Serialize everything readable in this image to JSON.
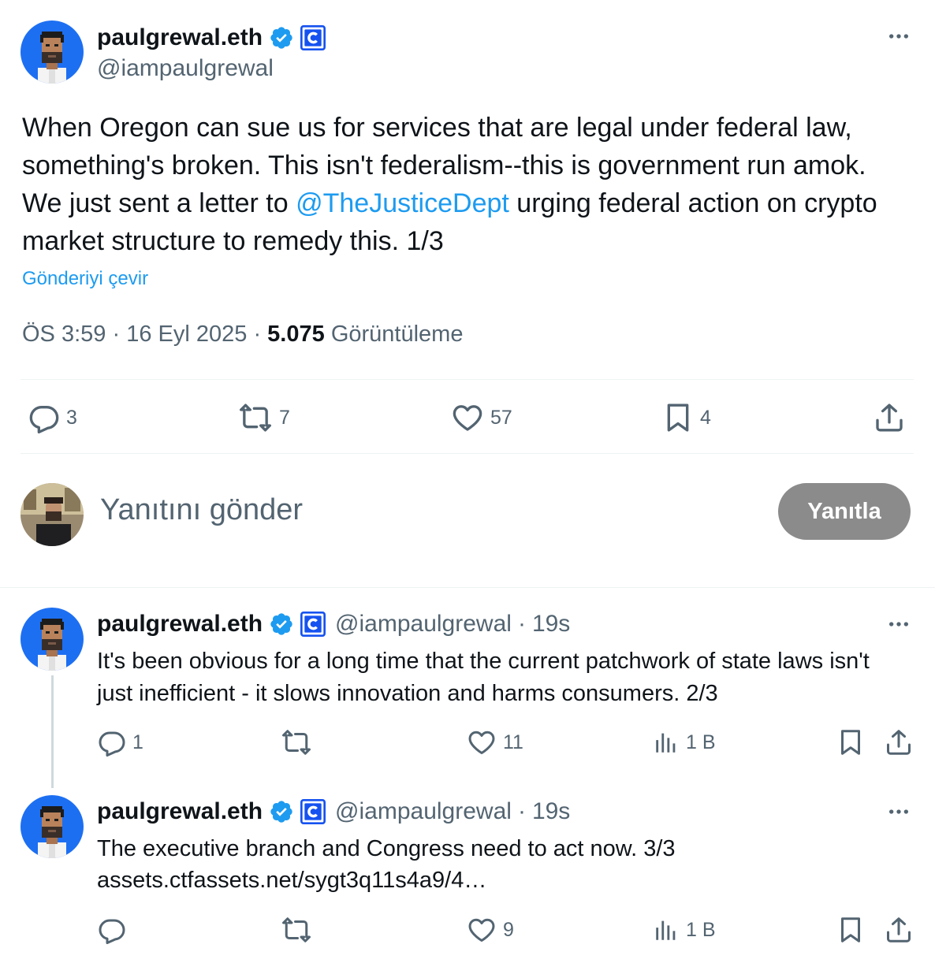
{
  "main_tweet": {
    "author_name": "paulgrewal.eth",
    "handle": "@iampaulgrewal",
    "text_before": "When Oregon can sue us for services that are legal under federal law, something's broken. This isn't federalism--this is government run amok. We just sent a letter to ",
    "mention": "@TheJusticeDept",
    "text_after": " urging federal action on crypto market structure to remedy this. 1/3",
    "translate": "Gönderiyi çevir",
    "time": "ÖS 3:59",
    "date": "16 Eyl 2025",
    "separator": "·",
    "views_count": "5.075",
    "views_label": "Görüntüleme",
    "replies": "3",
    "reposts": "7",
    "likes": "57",
    "bookmarks": "4"
  },
  "reply_box": {
    "placeholder": "Yanıtını gönder",
    "button": "Yanıtla"
  },
  "thread": [
    {
      "author_name": "paulgrewal.eth",
      "handle": "@iampaulgrewal",
      "dot": "·",
      "time": "19s",
      "text": "It's been obvious for a long time that the current patchwork of state laws isn't just inefficient - it slows innovation and harms consumers. 2/3",
      "link": "",
      "replies": "1",
      "reposts": "",
      "likes": "11",
      "views": "1 B"
    },
    {
      "author_name": "paulgrewal.eth",
      "handle": "@iampaulgrewal",
      "dot": "·",
      "time": "19s",
      "text": "The executive branch and Congress need to act now. 3/3",
      "link": "assets.ctfassets.net/sygt3q11s4a9/4…",
      "replies": "",
      "reposts": "",
      "likes": "9",
      "views": "1 B"
    }
  ],
  "colors": {
    "accent": "#1d9bf0",
    "verified": "#1d9bf0",
    "corp_badge": "#1652f0",
    "muted": "#536471",
    "button_disabled": "#8b8b8b"
  },
  "icons": [
    "more-icon",
    "verified-badge-icon",
    "coinbase-badge-icon",
    "reply-icon",
    "repost-icon",
    "like-icon",
    "bookmark-icon",
    "share-icon",
    "views-icon"
  ]
}
